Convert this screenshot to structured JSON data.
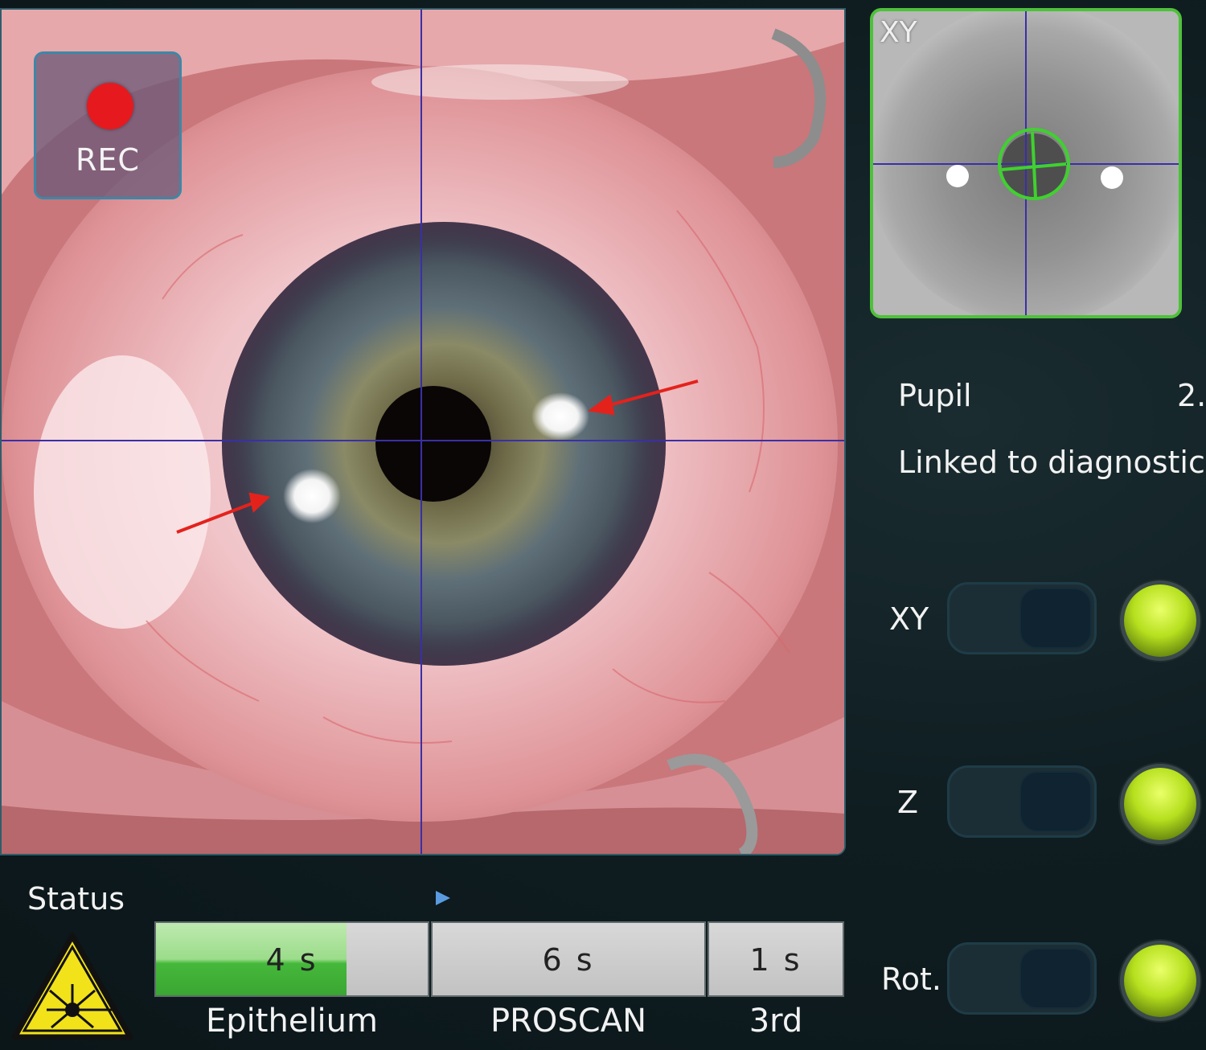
{
  "camera": {
    "rec_label": "REC",
    "crosshair_color": "#3a2fa8",
    "annotation_arrow_color": "#e4221c"
  },
  "xy_view": {
    "label": "XY",
    "tracking_ring_color": "#3fd12f"
  },
  "info": {
    "pupil_label": "Pupil",
    "pupil_value": "2.",
    "linked_text": "Linked to diagnostic"
  },
  "tracking": [
    {
      "label": "XY",
      "state": "on",
      "indicator": "green"
    },
    {
      "label": "Z",
      "state": "on",
      "indicator": "green"
    },
    {
      "label": "Rot.",
      "state": "on",
      "indicator": "green"
    }
  ],
  "status": {
    "title": "Status",
    "segments": [
      {
        "value": "4 s",
        "label": "Epithelium",
        "progress": 0.7
      },
      {
        "value": "6 s",
        "label": "PROSCAN",
        "progress": 0
      },
      {
        "value": "1 s",
        "label": "3rd",
        "progress": 0
      }
    ]
  },
  "icons": [
    "rec-dot-icon",
    "laser-warning-icon",
    "play-arrow-icon",
    "status-led-icon"
  ]
}
